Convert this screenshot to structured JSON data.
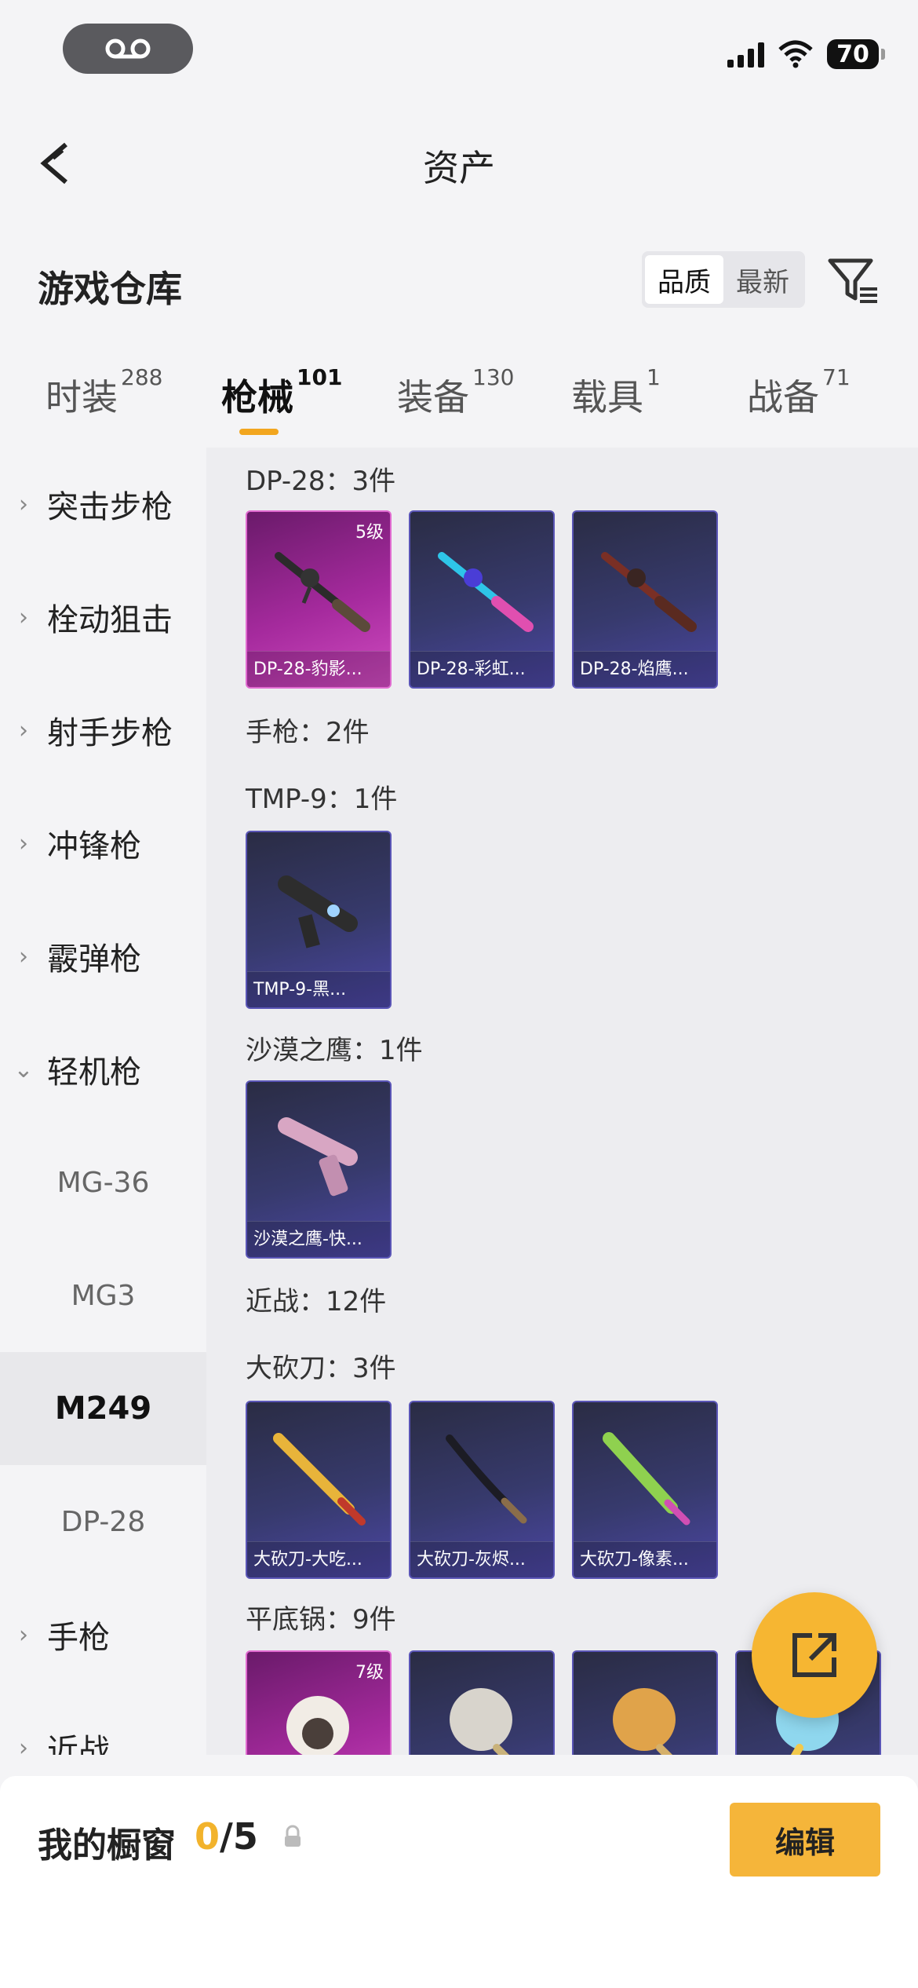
{
  "status_bar": {
    "battery": "70"
  },
  "nav": {
    "title": "资产"
  },
  "header": {
    "title": "游戏仓库",
    "sort_options": [
      "品质",
      "最新"
    ],
    "sort_active": "品质"
  },
  "tabs": [
    {
      "label": "时装",
      "count": "288"
    },
    {
      "label": "枪械",
      "count": "101"
    },
    {
      "label": "装备",
      "count": "130"
    },
    {
      "label": "载具",
      "count": "1"
    },
    {
      "label": "战备",
      "count": "71"
    }
  ],
  "sidebar": {
    "categories": [
      "突击步枪",
      "栓动狙击",
      "射手步枪",
      "冲锋枪",
      "霰弹枪",
      "轻机枪"
    ],
    "subitems": [
      "MG-36",
      "MG3",
      "M249",
      "DP-28"
    ],
    "after": [
      "手枪",
      "近战"
    ],
    "selected": "M249"
  },
  "content": {
    "sections": [
      {
        "label": "DP-28：3件"
      },
      {
        "label": "手枪：2件"
      },
      {
        "label": "TMP-9：1件"
      },
      {
        "label": "沙漠之鹰：1件"
      },
      {
        "label": "近战：12件"
      },
      {
        "label": "大砍刀：3件"
      },
      {
        "label": "平底锅：9件"
      }
    ],
    "cards": [
      {
        "name": "DP-28-豹影...",
        "level": "5级",
        "icon": "rifle-icon"
      },
      {
        "name": "DP-28-彩虹...",
        "level": "",
        "icon": "rifle-icon"
      },
      {
        "name": "DP-28-焰鹰...",
        "level": "",
        "icon": "rifle-icon"
      },
      {
        "name": "TMP-9-黑...",
        "level": "",
        "icon": "smg-icon"
      },
      {
        "name": "沙漠之鹰-快...",
        "level": "",
        "icon": "pistol-icon"
      },
      {
        "name": "大砍刀-大吃...",
        "level": "",
        "icon": "machete-icon"
      },
      {
        "name": "大砍刀-灰烬...",
        "level": "",
        "icon": "machete-icon"
      },
      {
        "name": "大砍刀-像素...",
        "level": "",
        "icon": "machete-icon"
      },
      {
        "name": "",
        "level": "7级",
        "icon": "pan-icon"
      },
      {
        "name": "",
        "level": "",
        "icon": "pan-icon"
      },
      {
        "name": "",
        "level": "",
        "icon": "pan-icon"
      },
      {
        "name": "",
        "level": "",
        "icon": "pan-icon"
      }
    ]
  },
  "bottom": {
    "title": "我的橱窗",
    "count_current": "0",
    "count_total": "/5",
    "edit_label": "编辑"
  },
  "colors": {
    "accent": "#f2a61f",
    "edit_button": "#f5b53a",
    "card_purple": "#4b46a3",
    "card_pink": "#c23fb3"
  }
}
